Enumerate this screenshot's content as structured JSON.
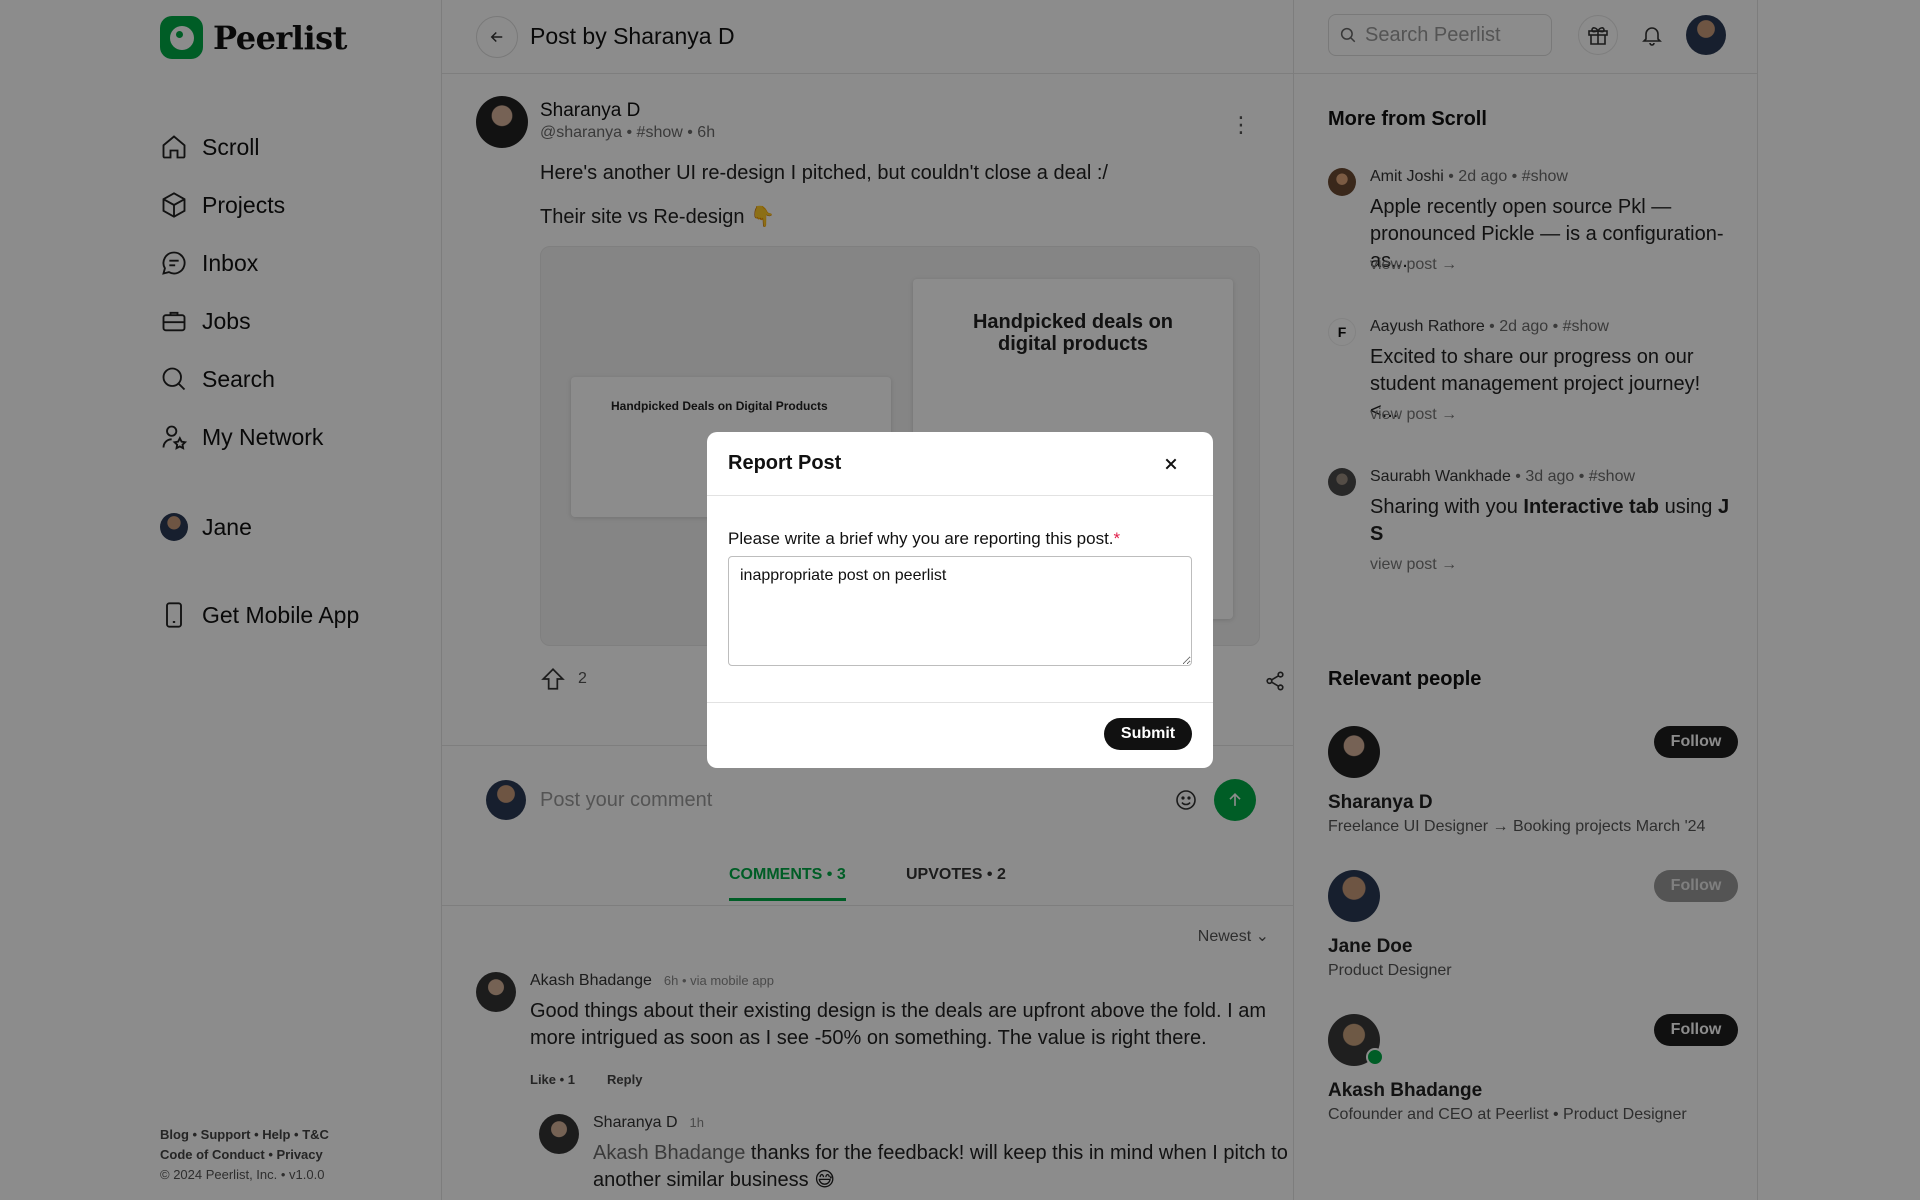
{
  "brand": {
    "name": "Peerlist",
    "accent": "#00aa45"
  },
  "sidebar": {
    "items": [
      {
        "label": "Scroll",
        "icon": "home-icon"
      },
      {
        "label": "Projects",
        "icon": "cube-icon"
      },
      {
        "label": "Inbox",
        "icon": "chat-icon"
      },
      {
        "label": "Jobs",
        "icon": "briefcase-icon"
      },
      {
        "label": "Search",
        "icon": "search-icon"
      },
      {
        "label": "My Network",
        "icon": "network-icon"
      }
    ],
    "profile_label": "Jane",
    "app_label": "Get Mobile App",
    "footer": {
      "line1": "Blog • Support • Help • T&C",
      "line2": "Code of Conduct • Privacy",
      "line3": "© 2024 Peerlist, Inc. • v1.0.0"
    }
  },
  "center": {
    "title": "Post by Sharanya D",
    "post": {
      "author": "Sharanya D",
      "meta": "@sharanya • #show • 6h",
      "text1": "Here's another UI re-design I pitched, but couldn't close a deal :/",
      "text2": "Their site vs Re-design 👇",
      "image_left_title": "Handpicked Deals on Digital Products",
      "image_right_title": "Handpicked deals on digital products",
      "upvotes": "2"
    },
    "comment_placeholder": "Post your comment",
    "tabs": {
      "comments": "COMMENTS • 3",
      "upvotes": "UPVOTES • 2"
    },
    "sort_label": "Newest",
    "comments": [
      {
        "author": "Akash Bhadange",
        "time": "6h • via mobile app",
        "text": "Good things about their existing design is the deals are upfront above the fold. I am more intrigued as soon as I see -50% on something. The value is right there.",
        "like": "Like • 1",
        "reply": "Reply"
      },
      {
        "author": "Sharanya D",
        "time": "1h",
        "mention": "Akash Bhadange",
        "text": " thanks for the feedback! will keep this in mind when I pitch to another similar business 😅"
      }
    ]
  },
  "right": {
    "search_placeholder": "Search Peerlist",
    "more_title": "More from Scroll",
    "more": [
      {
        "author": "Amit Joshi",
        "meta": " • 2d ago • #show",
        "text": "Apple recently open source Pkl — pronounced Pickle — is a configuration-as...",
        "link": "view post →"
      },
      {
        "author": "Aayush Rathore",
        "meta": " • 2d ago • #show",
        "text": "Excited to share our progress on our student management project journey! <...",
        "link": "view post →"
      },
      {
        "author": "Saurabh Wankhade",
        "meta": " • 3d ago • #show",
        "text_prefix": "Sharing with you ",
        "text_bold": "Interactive tab",
        "text_mid": " using ",
        "text_bold2": "J S",
        "link": "view post →"
      }
    ],
    "people_title": "Relevant people",
    "people": [
      {
        "name": "Sharanya D",
        "desc": "Freelance UI Designer → Booking projects March '24",
        "button": "Follow"
      },
      {
        "name": "Jane Doe",
        "desc": "Product Designer",
        "button": "Follow"
      },
      {
        "name": "Akash Bhadange",
        "desc": "Cofounder and CEO at Peerlist • Product Designer",
        "button": "Follow"
      }
    ]
  },
  "modal": {
    "title": "Report Post",
    "label": "Please write a brief why you are reporting this post.",
    "required_mark": "*",
    "value": "inappropriate post on peerlist",
    "submit": "Submit"
  }
}
